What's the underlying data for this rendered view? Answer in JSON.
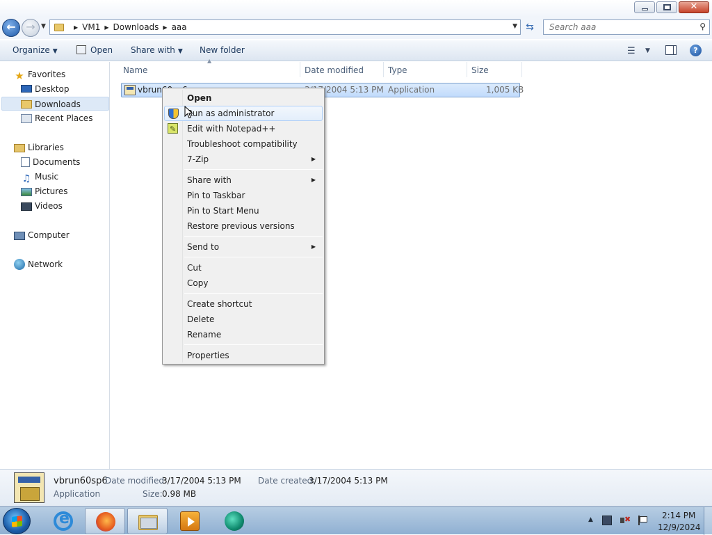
{
  "window": {
    "controls": {
      "minimize": "minimize",
      "maximize": "restore",
      "close": "✕"
    }
  },
  "address": {
    "breadcrumbs": [
      "VM1",
      "Downloads",
      "aaa"
    ],
    "search_placeholder": "Search aaa"
  },
  "toolbar": {
    "organize": "Organize",
    "open": "Open",
    "share_with": "Share with",
    "new_folder": "New folder"
  },
  "nav": {
    "favorites": "Favorites",
    "desktop": "Desktop",
    "downloads": "Downloads",
    "recent_places": "Recent Places",
    "libraries": "Libraries",
    "documents": "Documents",
    "music": "Music",
    "pictures": "Pictures",
    "videos": "Videos",
    "computer": "Computer",
    "network": "Network"
  },
  "columns": {
    "name": "Name",
    "date_modified": "Date modified",
    "type": "Type",
    "size": "Size"
  },
  "file": {
    "name_visible": "vbrun60sp6",
    "date_modified": "3/17/2004 5:13 PM",
    "type": "Application",
    "size": "1,005 KB"
  },
  "context_menu": {
    "open": "Open",
    "run_as_admin": "Run as administrator",
    "edit_notepadpp": "Edit with Notepad++",
    "troubleshoot": "Troubleshoot compatibility",
    "seven_zip": "7-Zip",
    "share_with": "Share with",
    "pin_taskbar": "Pin to Taskbar",
    "pin_start": "Pin to Start Menu",
    "restore_versions": "Restore previous versions",
    "send_to": "Send to",
    "cut": "Cut",
    "copy": "Copy",
    "create_shortcut": "Create shortcut",
    "delete": "Delete",
    "rename": "Rename",
    "properties": "Properties"
  },
  "details": {
    "name": "vbrun60sp6",
    "type": "Application",
    "date_modified_label": "Date modified:",
    "date_modified": "3/17/2004 5:13 PM",
    "date_created_label": "Date created:",
    "date_created": "3/17/2004 5:13 PM",
    "size_label": "Size:",
    "size": "0.98 MB"
  },
  "taskbar": {
    "time": "2:14 PM",
    "date": "12/9/2024",
    "pinned": [
      "internet-explorer",
      "firefox",
      "windows-explorer",
      "media-player",
      "app"
    ]
  }
}
